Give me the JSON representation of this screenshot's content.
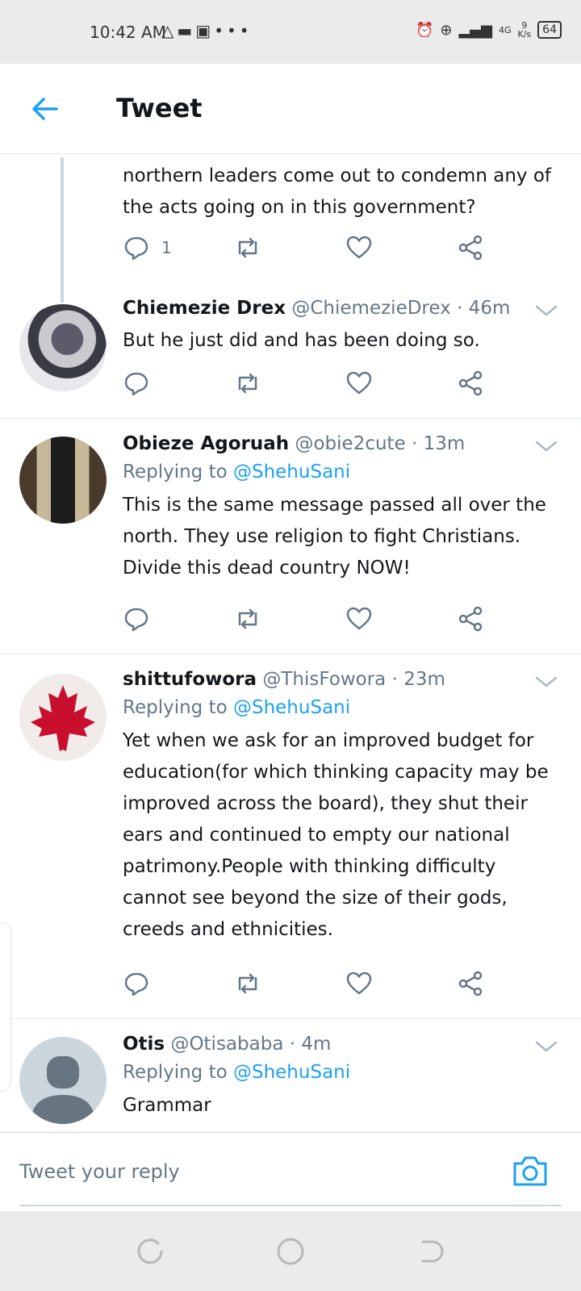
{
  "status_bar": {
    "time": "10:42 AM",
    "left_icons": [
      "warning-icon",
      "message-icon",
      "game-icon",
      "more-dots-icon"
    ],
    "network_type": "4G",
    "speed_value": "9",
    "speed_unit": "K/s",
    "battery": "64"
  },
  "header": {
    "title": "Tweet"
  },
  "tweets": [
    {
      "body": "northern leaders come out to condemn any of the acts going on in this government?",
      "reply_count": "1"
    },
    {
      "name": "Chiemezie Drex",
      "handle": "@ChiemezieDrex",
      "time": "· 46m",
      "body": "But he just did and has been doing so."
    },
    {
      "name": "Obieze Agoruah",
      "handle": "@obie2cute",
      "time": "· 13m",
      "replying_prefix": "Replying to",
      "replying_to": "@ShehuSani",
      "body": "This is the same message passed all over the north. They use religion to fight Christians. Divide this dead country NOW!"
    },
    {
      "name": "shittufowora",
      "handle": "@ThisFowora",
      "time": "· 23m",
      "replying_prefix": "Replying to",
      "replying_to": "@ShehuSani",
      "body": "Yet when we ask for an improved budget for education(for which thinking capacity may be improved across the board), they shut their ears and continued to empty our national patrimony.People with thinking difficulty cannot see beyond the size of their gods, creeds and ethnicities."
    },
    {
      "name": "Otis",
      "handle": "@Otisababa",
      "time": "· 4m",
      "replying_prefix": "Replying to",
      "replying_to": "@ShehuSani",
      "body": "Grammar"
    }
  ],
  "reply_bar": {
    "placeholder": "Tweet your reply"
  },
  "colors": {
    "accent": "#1da1f2",
    "secondary_text": "#657786",
    "primary_text": "#14171a",
    "divider": "#e1e8ed"
  }
}
